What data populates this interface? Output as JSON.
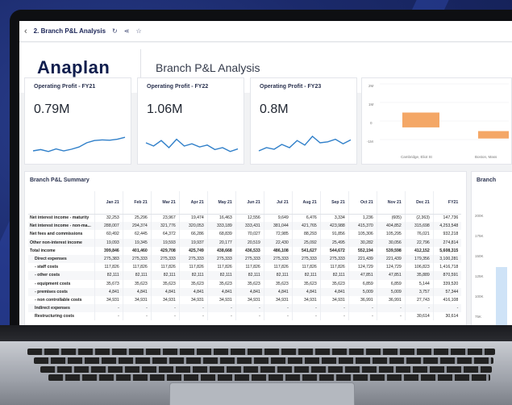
{
  "topbar": {
    "back_icon": "chevron-left-icon",
    "breadcrumb": "2. Branch P&L Analysis",
    "icons": [
      "refresh-icon",
      "share-icon",
      "star-icon"
    ]
  },
  "header": {
    "logo": "Anaplan",
    "title": "Branch P&L Analysis"
  },
  "kpis": [
    {
      "title": "Operating Profit - FY21",
      "value": "0.79M",
      "trend": [
        0.3,
        0.34,
        0.28,
        0.36,
        0.3,
        0.35,
        0.42,
        0.55,
        0.62,
        0.64,
        0.63,
        0.66,
        0.72
      ]
    },
    {
      "title": "Operating Profit - FY22",
      "value": "1.06M",
      "trend": [
        0.55,
        0.45,
        0.62,
        0.4,
        0.66,
        0.45,
        0.52,
        0.42,
        0.48,
        0.34,
        0.4,
        0.28,
        0.36
      ]
    },
    {
      "title": "Operating Profit - FY23",
      "value": "0.8M",
      "trend": [
        0.3,
        0.4,
        0.35,
        0.5,
        0.4,
        0.62,
        0.48,
        0.75,
        0.55,
        0.58,
        0.66,
        0.52,
        0.64
      ]
    }
  ],
  "branch_chart": {
    "y_ticks": [
      "2M",
      "1M",
      "0",
      "-1M"
    ],
    "categories": [
      "Cambridge, Eliot St",
      "Boston, Mass"
    ],
    "bars": [
      {
        "category": "Cambridge, Eliot St",
        "from": 0.5,
        "to": -0.3
      },
      {
        "category": "Boston, Mass",
        "from": -0.5,
        "to": -0.9
      }
    ],
    "bar_color": "#f4a766"
  },
  "summary": {
    "title": "Branch P&L Summary",
    "columns": [
      "Jan 21",
      "Feb 21",
      "Mar 21",
      "Apr 21",
      "May 21",
      "Jun 21",
      "Jul 21",
      "Aug 21",
      "Sep 21",
      "Oct 21",
      "Nov 21",
      "Dec 21",
      "FY21"
    ],
    "rows": [
      {
        "label": "Net interest income - maturity",
        "values": [
          "32,253",
          "25,296",
          "23,967",
          "19,474",
          "16,463",
          "12,556",
          "9,649",
          "6,476",
          "3,334",
          "1,236",
          "(605)",
          "(2,363)",
          "147,736"
        ]
      },
      {
        "label": "Net interest income - non-ma...",
        "values": [
          "288,007",
          "294,374",
          "321,776",
          "320,053",
          "333,189",
          "333,431",
          "381,044",
          "421,765",
          "423,988",
          "415,370",
          "404,852",
          "315,698",
          "4,253,548"
        ]
      },
      {
        "label": "Net fees and commissions",
        "values": [
          "60,492",
          "62,445",
          "64,372",
          "66,286",
          "68,839",
          "70,027",
          "72,985",
          "88,293",
          "91,856",
          "105,306",
          "105,295",
          "76,021",
          "932,218"
        ]
      },
      {
        "label": "Other non-interest income",
        "values": [
          "19,093",
          "19,345",
          "19,593",
          "19,937",
          "20,177",
          "20,519",
          "22,430",
          "25,092",
          "25,495",
          "30,282",
          "30,056",
          "22,796",
          "274,814"
        ]
      },
      {
        "label": "Total income",
        "values": [
          "399,846",
          "401,460",
          "429,708",
          "425,749",
          "438,668",
          "436,533",
          "486,108",
          "541,627",
          "544,672",
          "552,194",
          "539,598",
          "412,152",
          "5,608,315"
        ],
        "bold": true
      },
      {
        "label": "Direct expenses",
        "values": [
          "275,383",
          "275,333",
          "275,333",
          "275,333",
          "275,333",
          "275,333",
          "275,333",
          "275,333",
          "275,333",
          "221,439",
          "221,439",
          "179,356",
          "3,100,281"
        ],
        "indent": true
      },
      {
        "label": "- staff costs",
        "values": [
          "117,826",
          "117,826",
          "117,826",
          "117,826",
          "117,826",
          "117,826",
          "117,826",
          "117,826",
          "117,826",
          "124,729",
          "124,729",
          "106,823",
          "1,416,718"
        ],
        "indent": true
      },
      {
        "label": "- other costs",
        "values": [
          "82,111",
          "82,111",
          "82,111",
          "82,111",
          "82,111",
          "82,111",
          "82,111",
          "82,111",
          "82,111",
          "47,851",
          "47,851",
          "35,889",
          "870,591"
        ],
        "indent": true
      },
      {
        "label": "- equipment costs",
        "values": [
          "35,673",
          "35,623",
          "35,623",
          "35,623",
          "35,623",
          "35,623",
          "35,623",
          "35,623",
          "35,623",
          "6,859",
          "6,859",
          "5,144",
          "339,520"
        ],
        "indent": true
      },
      {
        "label": "- premises costs",
        "values": [
          "4,841",
          "4,841",
          "4,841",
          "4,841",
          "4,841",
          "4,841",
          "4,841",
          "4,841",
          "4,841",
          "5,009",
          "5,009",
          "3,757",
          "57,344"
        ],
        "indent": true
      },
      {
        "label": "- non controllable costs",
        "values": [
          "34,931",
          "34,931",
          "34,931",
          "34,931",
          "34,931",
          "34,931",
          "34,931",
          "34,931",
          "34,931",
          "36,991",
          "36,991",
          "27,743",
          "416,108"
        ],
        "indent": true
      },
      {
        "label": "Indirect expenses",
        "values": [
          "-",
          "-",
          "-",
          "-",
          "-",
          "-",
          "-",
          "-",
          "-",
          "-",
          "-",
          "-",
          "-"
        ],
        "indent": true
      },
      {
        "label": "Restructuring costs",
        "values": [
          "-",
          "-",
          "-",
          "-",
          "-",
          "-",
          "-",
          "-",
          "-",
          "-",
          "-",
          "30,614",
          "30,614"
        ],
        "indent": true
      }
    ]
  },
  "right_panel": {
    "title": "Branch",
    "y_ticks": [
      "200K",
      "175K",
      "150K",
      "125K",
      "100K",
      "75K",
      "50K"
    ]
  },
  "colors": {
    "navy": "#1b2557",
    "line": "#2f7fc9",
    "accent": "#f4a766"
  }
}
